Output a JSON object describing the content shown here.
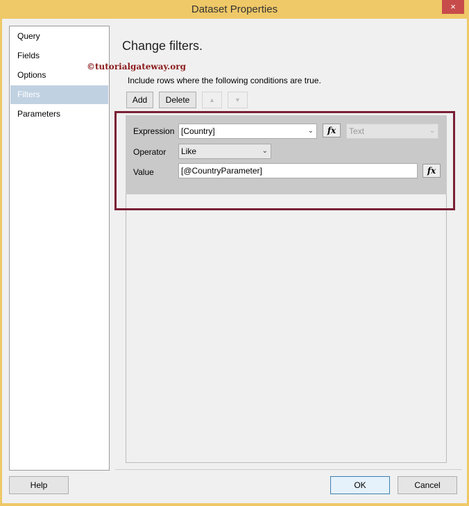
{
  "window": {
    "title": "Dataset Properties",
    "close_icon": "×"
  },
  "sidebar": {
    "items": [
      {
        "label": "Query"
      },
      {
        "label": "Fields"
      },
      {
        "label": "Options"
      },
      {
        "label": "Filters",
        "selected": true
      },
      {
        "label": "Parameters"
      }
    ]
  },
  "main": {
    "heading": "Change filters.",
    "watermark": "©tutorialgateway.org",
    "description": "Include rows where the following conditions are true.",
    "toolbar": {
      "add": "Add",
      "delete": "Delete",
      "up_icon": "▲",
      "down_icon": "▼"
    },
    "filter": {
      "expression_label": "Expression",
      "expression_value": "[Country]",
      "type_value": "Text",
      "operator_label": "Operator",
      "operator_value": "Like",
      "value_label": "Value",
      "value_value": "[@CountryParameter]",
      "fx_label": "fx"
    }
  },
  "footer": {
    "help": "Help",
    "ok": "OK",
    "cancel": "Cancel"
  },
  "colors": {
    "highlight_box": "#7a1f35",
    "titlebar": "#efc867"
  }
}
